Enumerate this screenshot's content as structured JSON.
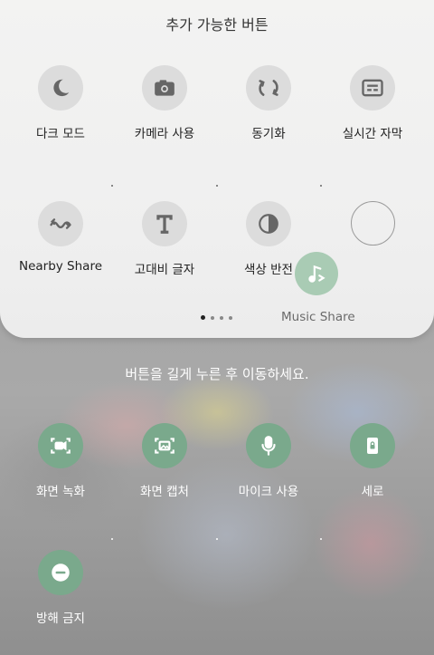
{
  "panel": {
    "title": "추가 가능한 버튼",
    "page_indicator": {
      "count": 4,
      "active": 1
    }
  },
  "available": [
    {
      "label": "다크 모드",
      "icon": "moon-icon"
    },
    {
      "label": "카메라 사용",
      "icon": "camera-icon"
    },
    {
      "label": "동기화",
      "icon": "sync-icon"
    },
    {
      "label": "실시간 자막",
      "icon": "live-caption-icon"
    },
    {
      "label": "Nearby Share",
      "icon": "nearby-share-icon"
    },
    {
      "label": "고대비 글자",
      "icon": "text-contrast-icon"
    },
    {
      "label": "색상 반전",
      "icon": "color-inversion-icon"
    },
    {
      "label": "",
      "icon": "empty-slot"
    }
  ],
  "dragging": {
    "label": "Music Share",
    "icon": "music-share-icon"
  },
  "hint": "버튼을 길게 누른 후 이동하세요.",
  "active": [
    {
      "label": "화면 녹화",
      "icon": "screen-record-icon"
    },
    {
      "label": "화면 캡처",
      "icon": "screen-capture-icon"
    },
    {
      "label": "마이크 사용",
      "icon": "microphone-icon"
    },
    {
      "label": "세로",
      "icon": "portrait-lock-icon"
    },
    {
      "label": "방해 금지",
      "icon": "do-not-disturb-icon"
    }
  ],
  "colors": {
    "active_tile": "#7aa98c",
    "dragging_tile": "#a9cbb4",
    "available_tile": "#dcdcdc"
  }
}
